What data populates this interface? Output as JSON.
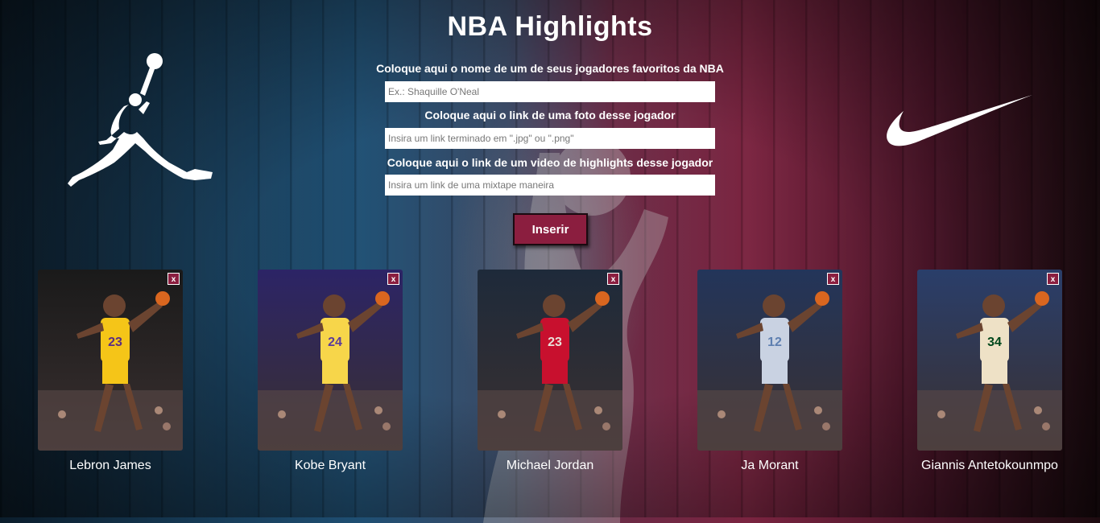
{
  "header": {
    "title": "NBA Highlights"
  },
  "form": {
    "player_label": "Coloque aqui o nome de um de seus jogadores favoritos da NBA",
    "player_placeholder": "Ex.: Shaquille O'Neal",
    "photo_label": "Coloque aqui o link de uma foto desse jogador",
    "photo_placeholder": "Insira um link terminado em \".jpg\" ou \".png\"",
    "video_label": "Coloque aqui o link de um video de highlights desse jogador",
    "video_placeholder": "Insira um link de uma mixtape maneira",
    "submit_label": "Inserir"
  },
  "logos": {
    "left": "jumpman-logo",
    "right": "nike-swoosh-logo"
  },
  "players": [
    {
      "name": "Lebron James",
      "close_label": "x",
      "jersey": "23",
      "colors": [
        "#1a1a1a",
        "#f5c518",
        "#5a2d82"
      ]
    },
    {
      "name": "Kobe Bryant",
      "close_label": "x",
      "jersey": "24",
      "colors": [
        "#2c2466",
        "#f7d64a",
        "#5b3b9a"
      ]
    },
    {
      "name": "Michael Jordan",
      "close_label": "x",
      "jersey": "23",
      "colors": [
        "#1e2a3a",
        "#c8102e",
        "#e8e0d8"
      ]
    },
    {
      "name": "Ja Morant",
      "close_label": "x",
      "jersey": "12",
      "colors": [
        "#23355a",
        "#c9d2e2",
        "#5e7fb0"
      ]
    },
    {
      "name": "Giannis Antetokounmpo",
      "close_label": "x",
      "jersey": "34",
      "colors": [
        "#2a3e6a",
        "#eee1c6",
        "#00471b"
      ]
    }
  ],
  "colors": {
    "accent": "#8b1e3f"
  }
}
